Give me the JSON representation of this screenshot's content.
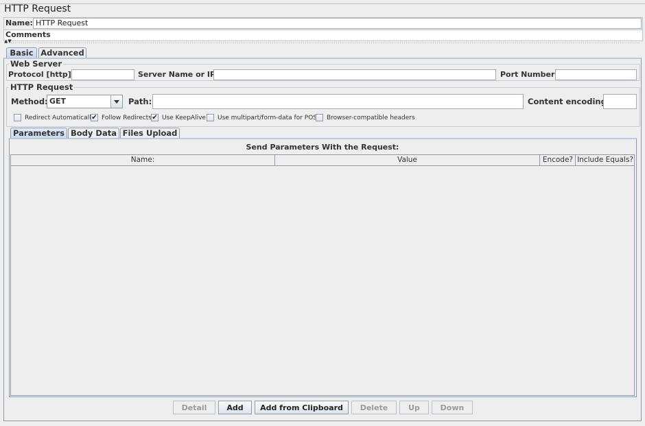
{
  "panel_title": "HTTP Request",
  "name_label": "Name:",
  "name_value": "HTTP Request",
  "comments_label": "Comments:",
  "comments_value": "",
  "main_tabs": [
    {
      "label": "Basic",
      "active": true
    },
    {
      "label": "Advanced",
      "active": false
    }
  ],
  "web_server": {
    "title": "Web Server",
    "protocol_label": "Protocol [http]:",
    "protocol_value": "",
    "server_label": "Server Name or IP:",
    "server_value": "",
    "port_label": "Port Number:",
    "port_value": ""
  },
  "http_request": {
    "title": "HTTP Request",
    "method_label": "Method:",
    "method_value": "GET",
    "path_label": "Path:",
    "path_value": "",
    "encoding_label": "Content encoding:",
    "encoding_value": ""
  },
  "options": [
    {
      "label": "Redirect Automatically",
      "checked": false
    },
    {
      "label": "Follow Redirects",
      "checked": true
    },
    {
      "label": "Use KeepAlive",
      "checked": true
    },
    {
      "label": "Use multipart/form-data for POST",
      "checked": false
    },
    {
      "label": "Browser-compatible headers",
      "checked": false
    }
  ],
  "sub_tabs": [
    {
      "label": "Parameters",
      "active": true
    },
    {
      "label": "Body Data",
      "active": false
    },
    {
      "label": "Files Upload",
      "active": false
    }
  ],
  "params_table": {
    "caption": "Send Parameters With the Request:",
    "columns": [
      "Name:",
      "Value",
      "Encode?",
      "Include Equals?"
    ],
    "rows": []
  },
  "buttons": [
    {
      "label": "Detail",
      "enabled": false
    },
    {
      "label": "Add",
      "enabled": true
    },
    {
      "label": "Add from Clipboard",
      "enabled": true
    },
    {
      "label": "Delete",
      "enabled": false
    },
    {
      "label": "Up",
      "enabled": false
    },
    {
      "label": "Down",
      "enabled": false
    }
  ],
  "check_glyph": "✔"
}
